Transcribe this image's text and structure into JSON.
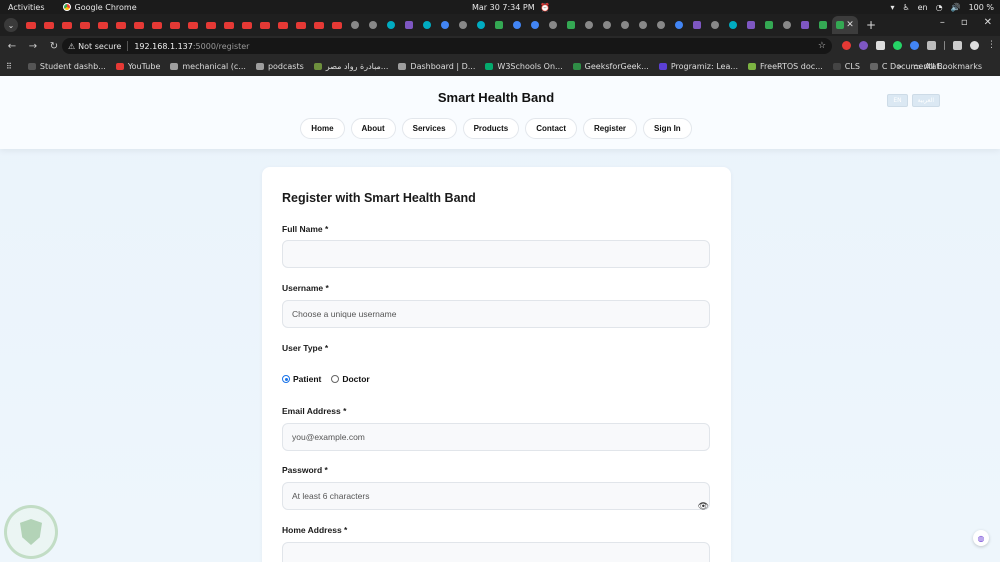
{
  "os": {
    "activities": "Activities",
    "app_name": "Google Chrome",
    "clock": "Mar 30  7:34 PM",
    "lang": "en",
    "battery": "100 %"
  },
  "browser": {
    "not_secure": "Not secure",
    "host": "192.168.1.137",
    "path": ":5000/register",
    "bookmarks": [
      {
        "label": "Student dashb...",
        "color": "#555555"
      },
      {
        "label": "YouTube",
        "color": "#e53935"
      },
      {
        "label": "mechanical (c...",
        "color": "#9e9e9e"
      },
      {
        "label": "podcasts",
        "color": "#9e9e9e"
      },
      {
        "label": "مبادرة رواد مصر...",
        "color": "#6d8f3d"
      },
      {
        "label": "Dashboard | D...",
        "color": "#9e9e9e"
      },
      {
        "label": "W3Schools On...",
        "color": "#04aa6d"
      },
      {
        "label": "GeeksforGeek...",
        "color": "#2f8d46"
      },
      {
        "label": "Programiz: Lea...",
        "color": "#5b3fd4"
      },
      {
        "label": "FreeRTOS doc...",
        "color": "#7cb342"
      },
      {
        "label": "CLS",
        "color": "#444444"
      },
      {
        "label": "C Documentat...",
        "color": "#666666"
      }
    ],
    "all_bookmarks": "All Bookmarks"
  },
  "site": {
    "brand": "Smart Health Band",
    "lang_en": "EN",
    "lang_ar": "العربية",
    "nav": [
      "Home",
      "About",
      "Services",
      "Products",
      "Contact",
      "Register",
      "Sign In"
    ]
  },
  "form": {
    "title": "Register with Smart Health Band",
    "full_name_label": "Full Name *",
    "username_label": "Username *",
    "username_placeholder": "Choose a unique username",
    "user_type_label": "User Type *",
    "patient": "Patient",
    "doctor": "Doctor",
    "email_label": "Email Address *",
    "email_placeholder": "you@example.com",
    "password_label": "Password *",
    "password_placeholder": "At least 6 characters",
    "address_label": "Home Address *"
  }
}
